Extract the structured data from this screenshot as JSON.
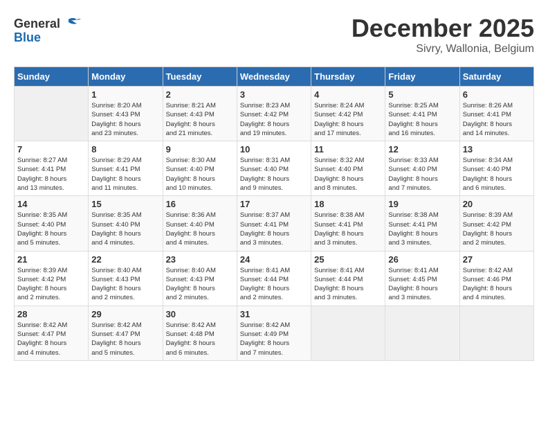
{
  "header": {
    "logo_general": "General",
    "logo_blue": "Blue",
    "month_title": "December 2025",
    "location": "Sivry, Wallonia, Belgium"
  },
  "days_of_week": [
    "Sunday",
    "Monday",
    "Tuesday",
    "Wednesday",
    "Thursday",
    "Friday",
    "Saturday"
  ],
  "weeks": [
    [
      {
        "day": "",
        "info": ""
      },
      {
        "day": "1",
        "info": "Sunrise: 8:20 AM\nSunset: 4:43 PM\nDaylight: 8 hours\nand 23 minutes."
      },
      {
        "day": "2",
        "info": "Sunrise: 8:21 AM\nSunset: 4:43 PM\nDaylight: 8 hours\nand 21 minutes."
      },
      {
        "day": "3",
        "info": "Sunrise: 8:23 AM\nSunset: 4:42 PM\nDaylight: 8 hours\nand 19 minutes."
      },
      {
        "day": "4",
        "info": "Sunrise: 8:24 AM\nSunset: 4:42 PM\nDaylight: 8 hours\nand 17 minutes."
      },
      {
        "day": "5",
        "info": "Sunrise: 8:25 AM\nSunset: 4:41 PM\nDaylight: 8 hours\nand 16 minutes."
      },
      {
        "day": "6",
        "info": "Sunrise: 8:26 AM\nSunset: 4:41 PM\nDaylight: 8 hours\nand 14 minutes."
      }
    ],
    [
      {
        "day": "7",
        "info": "Sunrise: 8:27 AM\nSunset: 4:41 PM\nDaylight: 8 hours\nand 13 minutes."
      },
      {
        "day": "8",
        "info": "Sunrise: 8:29 AM\nSunset: 4:41 PM\nDaylight: 8 hours\nand 11 minutes."
      },
      {
        "day": "9",
        "info": "Sunrise: 8:30 AM\nSunset: 4:40 PM\nDaylight: 8 hours\nand 10 minutes."
      },
      {
        "day": "10",
        "info": "Sunrise: 8:31 AM\nSunset: 4:40 PM\nDaylight: 8 hours\nand 9 minutes."
      },
      {
        "day": "11",
        "info": "Sunrise: 8:32 AM\nSunset: 4:40 PM\nDaylight: 8 hours\nand 8 minutes."
      },
      {
        "day": "12",
        "info": "Sunrise: 8:33 AM\nSunset: 4:40 PM\nDaylight: 8 hours\nand 7 minutes."
      },
      {
        "day": "13",
        "info": "Sunrise: 8:34 AM\nSunset: 4:40 PM\nDaylight: 8 hours\nand 6 minutes."
      }
    ],
    [
      {
        "day": "14",
        "info": "Sunrise: 8:35 AM\nSunset: 4:40 PM\nDaylight: 8 hours\nand 5 minutes."
      },
      {
        "day": "15",
        "info": "Sunrise: 8:35 AM\nSunset: 4:40 PM\nDaylight: 8 hours\nand 4 minutes."
      },
      {
        "day": "16",
        "info": "Sunrise: 8:36 AM\nSunset: 4:40 PM\nDaylight: 8 hours\nand 4 minutes."
      },
      {
        "day": "17",
        "info": "Sunrise: 8:37 AM\nSunset: 4:41 PM\nDaylight: 8 hours\nand 3 minutes."
      },
      {
        "day": "18",
        "info": "Sunrise: 8:38 AM\nSunset: 4:41 PM\nDaylight: 8 hours\nand 3 minutes."
      },
      {
        "day": "19",
        "info": "Sunrise: 8:38 AM\nSunset: 4:41 PM\nDaylight: 8 hours\nand 3 minutes."
      },
      {
        "day": "20",
        "info": "Sunrise: 8:39 AM\nSunset: 4:42 PM\nDaylight: 8 hours\nand 2 minutes."
      }
    ],
    [
      {
        "day": "21",
        "info": "Sunrise: 8:39 AM\nSunset: 4:42 PM\nDaylight: 8 hours\nand 2 minutes."
      },
      {
        "day": "22",
        "info": "Sunrise: 8:40 AM\nSunset: 4:43 PM\nDaylight: 8 hours\nand 2 minutes."
      },
      {
        "day": "23",
        "info": "Sunrise: 8:40 AM\nSunset: 4:43 PM\nDaylight: 8 hours\nand 2 minutes."
      },
      {
        "day": "24",
        "info": "Sunrise: 8:41 AM\nSunset: 4:44 PM\nDaylight: 8 hours\nand 2 minutes."
      },
      {
        "day": "25",
        "info": "Sunrise: 8:41 AM\nSunset: 4:44 PM\nDaylight: 8 hours\nand 3 minutes."
      },
      {
        "day": "26",
        "info": "Sunrise: 8:41 AM\nSunset: 4:45 PM\nDaylight: 8 hours\nand 3 minutes."
      },
      {
        "day": "27",
        "info": "Sunrise: 8:42 AM\nSunset: 4:46 PM\nDaylight: 8 hours\nand 4 minutes."
      }
    ],
    [
      {
        "day": "28",
        "info": "Sunrise: 8:42 AM\nSunset: 4:47 PM\nDaylight: 8 hours\nand 4 minutes."
      },
      {
        "day": "29",
        "info": "Sunrise: 8:42 AM\nSunset: 4:47 PM\nDaylight: 8 hours\nand 5 minutes."
      },
      {
        "day": "30",
        "info": "Sunrise: 8:42 AM\nSunset: 4:48 PM\nDaylight: 8 hours\nand 6 minutes."
      },
      {
        "day": "31",
        "info": "Sunrise: 8:42 AM\nSunset: 4:49 PM\nDaylight: 8 hours\nand 7 minutes."
      },
      {
        "day": "",
        "info": ""
      },
      {
        "day": "",
        "info": ""
      },
      {
        "day": "",
        "info": ""
      }
    ]
  ]
}
